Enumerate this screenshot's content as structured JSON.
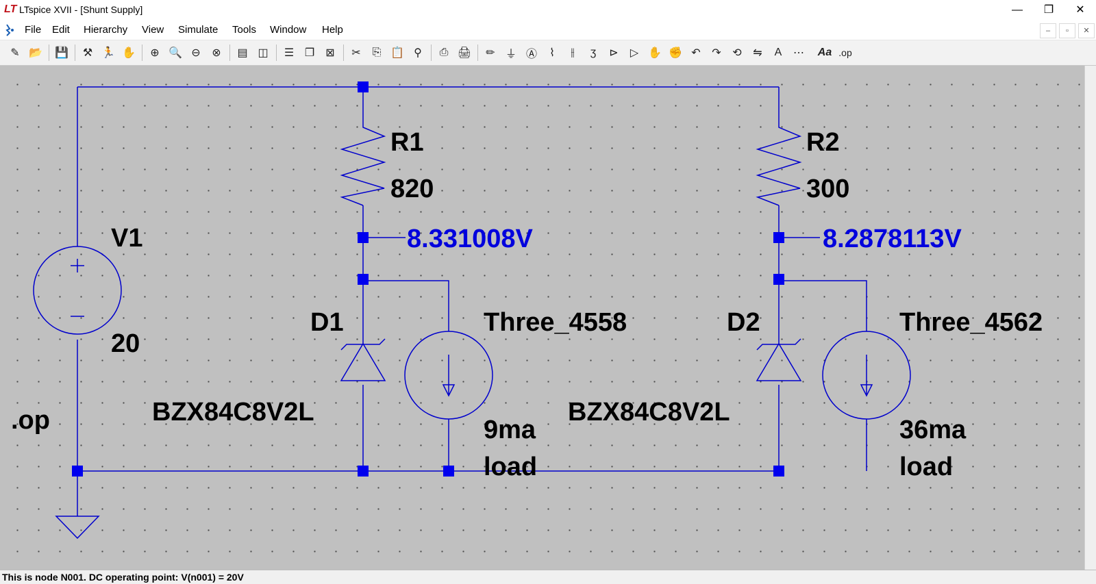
{
  "window": {
    "title": "LTspice XVII - [Shunt Supply]",
    "app_icon": "LT",
    "minimize": "—",
    "restore": "❐",
    "close": "✕"
  },
  "menu": [
    "File",
    "Edit",
    "Hierarchy",
    "View",
    "Simulate",
    "Tools",
    "Window",
    "Help"
  ],
  "mdi_controls": [
    "–",
    "▫",
    "✕"
  ],
  "toolbar": {
    "groups": [
      [
        "new-schematic-icon",
        "open-icon"
      ],
      [
        "save-icon"
      ],
      [
        "control-panel-icon",
        "run-icon",
        "halt-icon"
      ],
      [
        "zoom-in-icon",
        "zoom-pan-icon",
        "zoom-out-icon",
        "zoom-fit-icon"
      ],
      [
        "autorange-icon",
        "waveform-icon"
      ],
      [
        "tile-horizontal-icon",
        "cascade-icon",
        "close-window-icon"
      ],
      [
        "cut-icon",
        "copy-icon",
        "paste-icon",
        "find-icon"
      ],
      [
        "print-setup-icon",
        "print-icon"
      ],
      [
        "draw-wire-icon",
        "ground-icon",
        "label-net-icon",
        "resistor-icon",
        "capacitor-icon",
        "inductor-icon",
        "diode-icon",
        "component-icon",
        "move-icon",
        "drag-icon",
        "undo-icon",
        "redo-icon",
        "rotate-icon",
        "mirror-icon",
        "text-icon",
        "spice-directive-icon"
      ]
    ],
    "text_button": "Aa",
    "directive_button": ".op"
  },
  "schematic": {
    "wire_color": "#0000cc",
    "node_color": "#0000ee",
    "labels": {
      "v1_name": "V1",
      "v1_value": "20",
      "directive": ".op",
      "r1_name": "R1",
      "r1_value": "820",
      "r1_voltage": "8.331008V",
      "d1_name": "D1",
      "d1_part": "BZX84C8V2L",
      "i1_name": "Three_4558",
      "i1_value_line1": "9ma",
      "i1_value_line2": "load",
      "r2_name": "R2",
      "r2_value": "300",
      "r2_voltage": "8.2878113V",
      "d2_name": "D2",
      "d2_part": "BZX84C8V2L",
      "i2_name": "Three_4562",
      "i2_value_line1": "36ma",
      "i2_value_line2": "load"
    }
  },
  "status": "This is node N001.  DC operating point: V(n001) = 20V"
}
